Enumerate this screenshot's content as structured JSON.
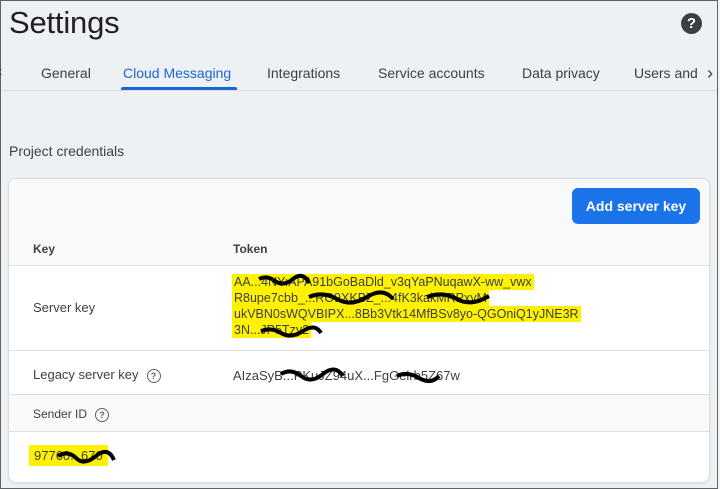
{
  "header": {
    "title": "Settings",
    "help_symbol": "?"
  },
  "tabs": [
    {
      "label": "General",
      "active": false
    },
    {
      "label": "Cloud Messaging",
      "active": true
    },
    {
      "label": "Integrations",
      "active": false
    },
    {
      "label": "Service accounts",
      "active": false
    },
    {
      "label": "Data privacy",
      "active": false
    },
    {
      "label": "Users and",
      "active": false
    }
  ],
  "section_title": "Project credentials",
  "card": {
    "add_button_label": "Add server key",
    "col_key": "Key",
    "col_token": "Token",
    "server_key_label": "Server key",
    "server_key_token_lines": [
      "AA...4NY:APA91bGoBaDld_v3qYaPNuqawX-ww_vwx",
      "R8upe7cbb_...RO9XKBZ_...4fK3kakMRPxyM",
      "ukVBN0sWQVBIPX...8Bb3Vtk14MfBSv8yo-QGOniQ1yJNE3R",
      "3N...JP5Tzy2"
    ],
    "legacy_key_label": "Legacy server key",
    "legacy_key_value": "AIzaSyB...PKuJZ94uX...FgGelrb5Z67w",
    "sender_id_label": "Sender ID",
    "sender_id_value": "97760...670"
  },
  "colors": {
    "accent": "#1a73e8",
    "highlight": "#fff200"
  }
}
